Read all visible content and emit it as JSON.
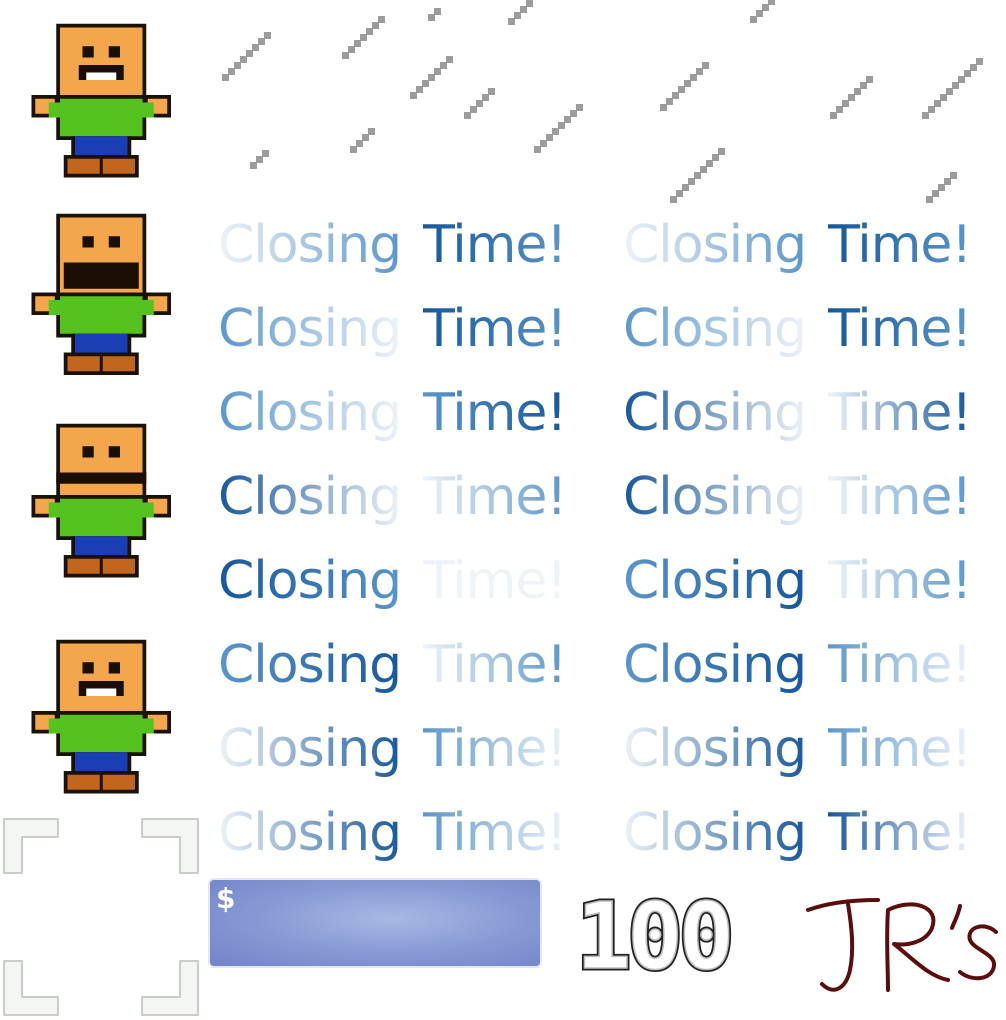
{
  "banner": {
    "word1": "Closing",
    "word2": "Time!",
    "rows": 8,
    "columns": 2
  },
  "money": {
    "symbol": "$"
  },
  "score": {
    "value": "100"
  },
  "logo": {
    "text": "JR's"
  },
  "colors": {
    "skin": "#f4a64c",
    "shirt": "#56c21f",
    "pants": "#1a3fb4",
    "shoes": "#c2651d",
    "outline": "#1a1108",
    "rain": "#9c9c9c",
    "text_dark": "#17579a",
    "text_light": "#eef3f8",
    "money_panel": "#8597d4",
    "logo_ink": "#5a0d0d"
  }
}
